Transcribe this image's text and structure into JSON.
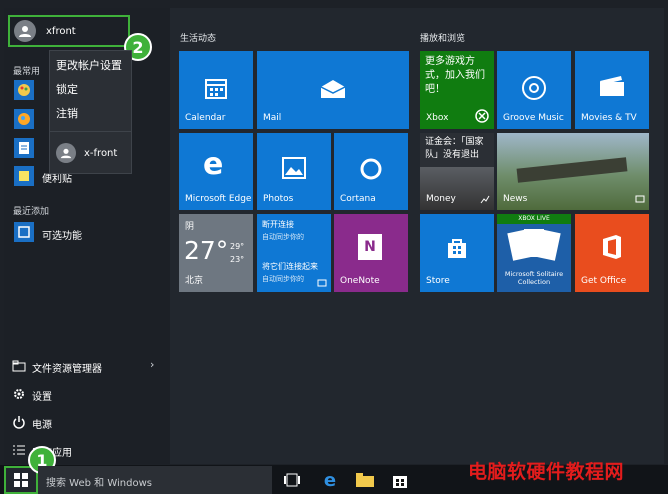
{
  "user": {
    "name": "xfront"
  },
  "flyout": {
    "items": [
      "更改帐户设置",
      "锁定",
      "注销"
    ],
    "other_user": "x-front"
  },
  "badges": {
    "one": "1",
    "two": "2"
  },
  "left": {
    "most_used": "最常用",
    "recent_label": "最近添加",
    "most_used_items": [
      "",
      "",
      "",
      "便利贴"
    ],
    "recent_item": "可选功能",
    "bottom_items": [
      "文件资源管理器",
      "设置",
      "电源",
      "所有应用"
    ]
  },
  "sections": {
    "left": "生活动态",
    "right": "播放和浏览"
  },
  "tiles": {
    "calendar": "Calendar",
    "mail": "Mail",
    "edge": "Microsoft Edge",
    "photos": "Photos",
    "cortana": "Cortana",
    "weather": {
      "condition": "阴",
      "temp": "27°",
      "high": "29°",
      "low": "23°",
      "city": "北京"
    },
    "news_top": {
      "title": "断开连接",
      "sub": "自动同步你的"
    },
    "news_bottom": {
      "title": "将它们连接起来",
      "sub": "自动同步你的"
    },
    "onenote": "OneNote",
    "xbox": {
      "text": "更多游戏方式，加入我们吧！",
      "label": "Xbox"
    },
    "groove": "Groove Music",
    "movies": "Movies & TV",
    "money": {
      "headline": "证金会：「国家队」没有退出",
      "label": "Money"
    },
    "news": "News",
    "store": "Store",
    "solitaire": {
      "label": "Microsoft Solitaire Collection",
      "badge": "XBOX LIVE"
    },
    "getoffice": "Get Office"
  },
  "taskbar": {
    "search_placeholder": "搜索 Web 和 Windows"
  },
  "watermark": "电脑软硬件教程网",
  "colors": {
    "accent_blue": "#0f78d4",
    "xbox_green": "#107c10",
    "office_orange": "#e94d1e",
    "onenote_purple": "#8a2b8c",
    "badge_green": "#3fb13a"
  }
}
